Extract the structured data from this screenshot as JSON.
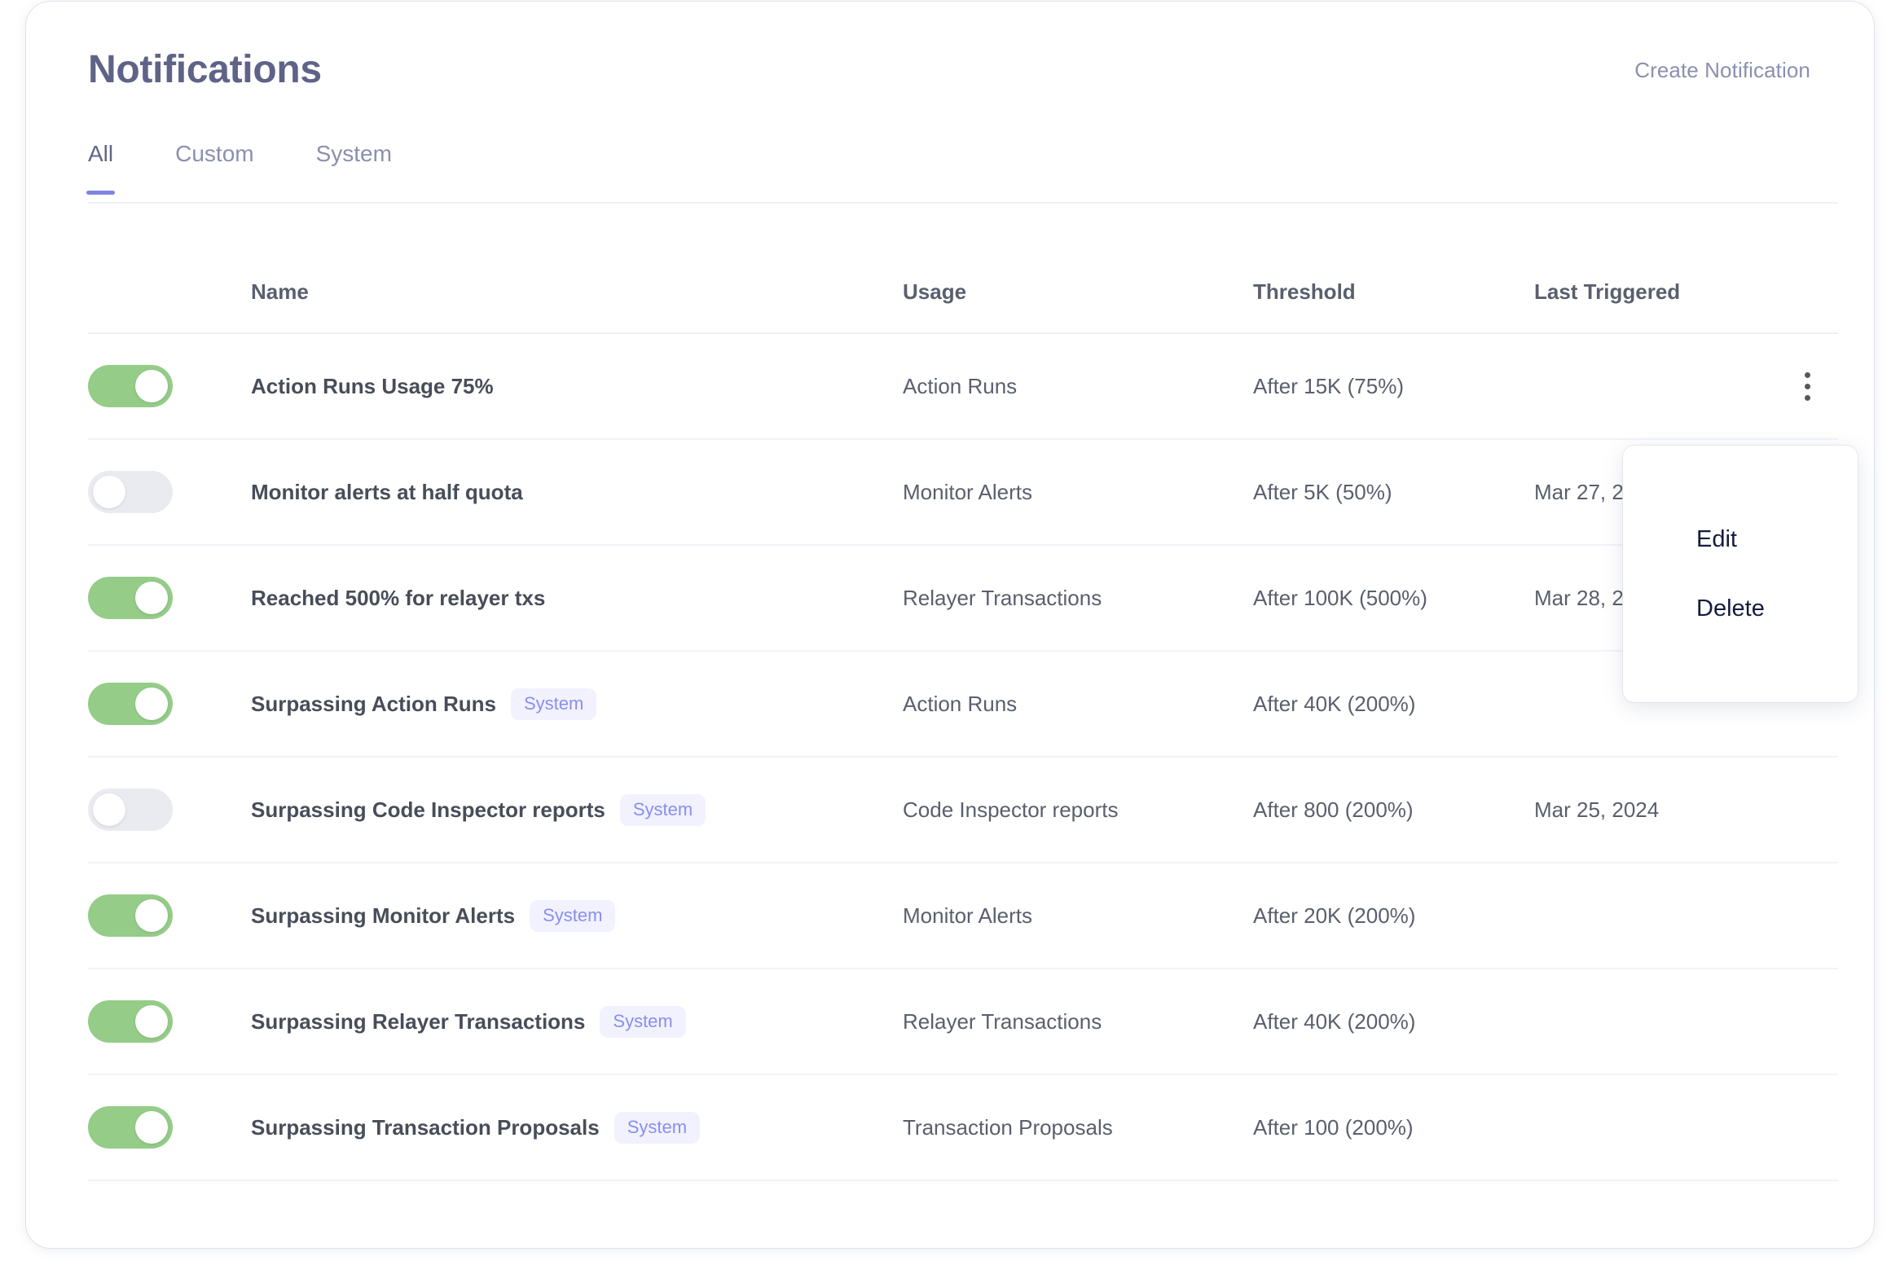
{
  "header": {
    "title": "Notifications",
    "create_label": "Create Notification"
  },
  "tabs": [
    {
      "label": "All",
      "active": true
    },
    {
      "label": "Custom",
      "active": false
    },
    {
      "label": "System",
      "active": false
    }
  ],
  "table": {
    "columns": {
      "name": "Name",
      "usage": "Usage",
      "threshold": "Threshold",
      "last_triggered": "Last Triggered"
    },
    "rows": [
      {
        "enabled": true,
        "name": "Action Runs Usage 75%",
        "badge": "",
        "usage": "Action Runs",
        "threshold": "After 15K (75%)",
        "last_triggered": "",
        "menu_open": true
      },
      {
        "enabled": false,
        "name": "Monitor alerts at half quota",
        "badge": "",
        "usage": "Monitor Alerts",
        "threshold": "After 5K (50%)",
        "last_triggered": "Mar 27, 2",
        "menu_open": false
      },
      {
        "enabled": true,
        "name": "Reached 500% for relayer txs",
        "badge": "",
        "usage": "Relayer Transactions",
        "threshold": "After 100K (500%)",
        "last_triggered": "Mar 28, 2",
        "menu_open": false
      },
      {
        "enabled": true,
        "name": "Surpassing Action Runs",
        "badge": "System",
        "usage": "Action Runs",
        "threshold": "After 40K (200%)",
        "last_triggered": "",
        "menu_open": false
      },
      {
        "enabled": false,
        "name": "Surpassing Code Inspector reports",
        "badge": "System",
        "usage": "Code Inspector reports",
        "threshold": "After 800 (200%)",
        "last_triggered": "Mar 25, 2024",
        "menu_open": false
      },
      {
        "enabled": true,
        "name": "Surpassing Monitor Alerts",
        "badge": "System",
        "usage": "Monitor Alerts",
        "threshold": "After 20K (200%)",
        "last_triggered": "",
        "menu_open": false
      },
      {
        "enabled": true,
        "name": "Surpassing Relayer Transactions",
        "badge": "System",
        "usage": "Relayer Transactions",
        "threshold": "After 40K (200%)",
        "last_triggered": "",
        "menu_open": false
      },
      {
        "enabled": true,
        "name": "Surpassing Transaction Proposals",
        "badge": "System",
        "usage": "Transaction Proposals",
        "threshold": "After 100 (200%)",
        "last_triggered": "",
        "menu_open": false
      }
    ]
  },
  "context_menu": {
    "visible": true,
    "items": [
      {
        "label": "Edit"
      },
      {
        "label": "Delete"
      }
    ]
  },
  "colors": {
    "toggle_on": "#94cc88",
    "toggle_off": "#eaebf0",
    "badge_text": "#8a8ef0",
    "badge_bg": "#f1f2fe",
    "tab_active_underline": "#7f83e0",
    "title": "#5f6387",
    "menu_text": "#141b3d"
  }
}
